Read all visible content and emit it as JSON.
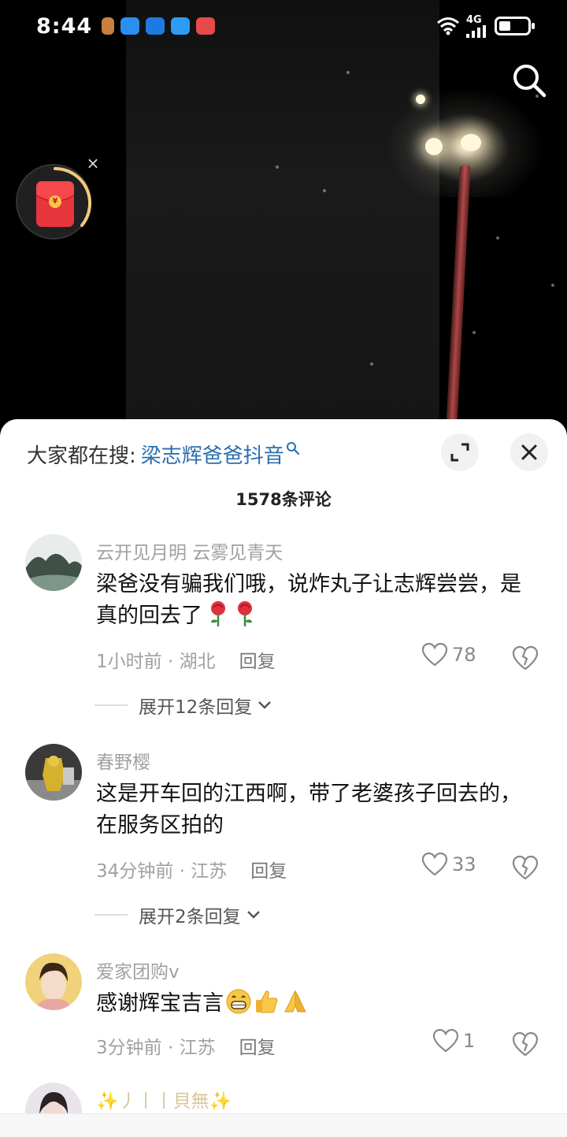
{
  "status_bar": {
    "time": "8:44",
    "network": "4G"
  },
  "panel": {
    "search_prefix": "大家都在搜:",
    "search_term": "梁志辉爸爸抖音",
    "comment_count": "1578条评论"
  },
  "comments": [
    {
      "user": "云开见月明 云雾见青天",
      "text": "梁爸没有骗我们哦，说炸丸子让志辉尝尝，是真的回去了",
      "time_location": "1小时前 · 湖北",
      "reply_label": "回复",
      "likes": "78",
      "expand": "展开12条回复"
    },
    {
      "user": "春野樱",
      "text": "这是开车回的江西啊，带了老婆孩子回去的，在服务区拍的",
      "time_location": "34分钟前 · 江苏",
      "reply_label": "回复",
      "likes": "33",
      "expand": "展开2条回复"
    },
    {
      "user": "爱家团购v",
      "text": "感谢辉宝吉言",
      "time_location": "3分钟前 · 江苏",
      "reply_label": "回复",
      "likes": "1"
    },
    {
      "user": "✨丿丨丨貝無✨"
    }
  ],
  "icons": [
    "search-icon",
    "red-packet-icon",
    "close-icon",
    "expand-icon",
    "heart-icon",
    "broken-heart-icon",
    "chevron-down-icon",
    "rose-emoji",
    "grin-emoji",
    "thumbs-up-emoji",
    "pray-emoji"
  ],
  "colors": {
    "link_blue": "#2a6fb0",
    "meta_gray": "#a1a1a1",
    "red_packet": "#e8353b"
  }
}
